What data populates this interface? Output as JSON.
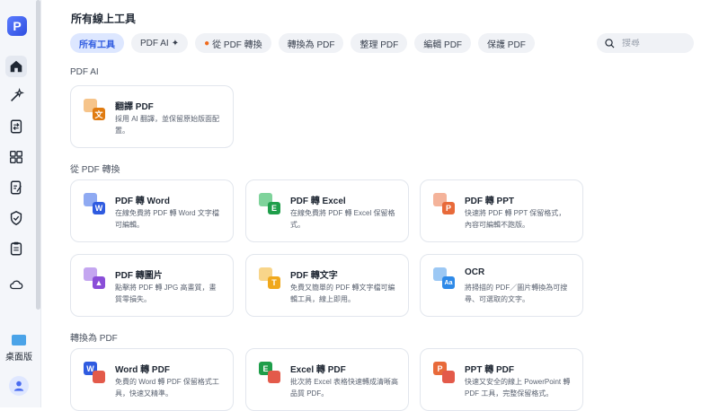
{
  "app": {
    "page_title": "所有線上工具"
  },
  "sidebar": {
    "logo_letter": "P",
    "items": [
      {
        "name": "home-icon"
      },
      {
        "name": "ai-sparkle-icon"
      },
      {
        "name": "convert-file-icon"
      },
      {
        "name": "grid-apps-icon"
      },
      {
        "name": "edit-file-icon"
      },
      {
        "name": "shield-icon"
      },
      {
        "name": "clipboard-icon"
      },
      {
        "name": "cloud-icon"
      }
    ],
    "desktop_label": "桌面版"
  },
  "tabs": [
    {
      "label": "所有工具",
      "active": true
    },
    {
      "label": "PDF AI"
    },
    {
      "label": "從 PDF 轉換"
    },
    {
      "label": "轉換為 PDF"
    },
    {
      "label": "整理 PDF"
    },
    {
      "label": "編輯 PDF"
    },
    {
      "label": "保護 PDF"
    }
  ],
  "search": {
    "placeholder": "搜尋"
  },
  "sections": [
    {
      "label": "PDF AI",
      "cards": [
        {
          "title": "翻譯 PDF",
          "desc": "採用 AI 翻譯，並保留原始版面配置。",
          "color": "#e07b10",
          "letter": "文"
        }
      ]
    },
    {
      "label": "從 PDF 轉換",
      "cards": [
        {
          "title": "PDF 轉 Word",
          "desc": "在線免費將 PDF 轉 Word 文字檔可編輯。",
          "color": "#2f5be0",
          "letter": "W"
        },
        {
          "title": "PDF 轉 Excel",
          "desc": "在線免費將 PDF 轉 Excel 保留格式。",
          "color": "#1e9e4a",
          "letter": "E"
        },
        {
          "title": "PDF 轉 PPT",
          "desc": "快速將 PDF 轉 PPT 保留格式，內容可編輯不跑版。",
          "color": "#e86a3a",
          "letter": "P"
        },
        {
          "title": "PDF 轉圖片",
          "desc": "點擊將 PDF 轉 JPG 高畫質，畫質零損失。",
          "color": "#8a4ed8",
          "letter": "▲"
        },
        {
          "title": "PDF 轉文字",
          "desc": "免費又簡單的 PDF 轉文字檔可編輯工具，線上即用。",
          "color": "#f0a81c",
          "letter": "T"
        },
        {
          "title": "OCR",
          "desc": "將掃描的 PDF／圖片轉換為可搜尋、可選取的文字。",
          "color": "#2f8ae8",
          "letter": "Aa"
        }
      ]
    },
    {
      "label": "轉換為 PDF",
      "cards": [
        {
          "title": "Word 轉 PDF",
          "desc": "免費的 Word 轉 PDF 保留格式工具，快速又精準。",
          "color": "#2f5be0",
          "letter": "W"
        },
        {
          "title": "Excel 轉 PDF",
          "desc": "批次將 Excel 表格快速轉成清晰高品質 PDF。",
          "color": "#1e9e4a",
          "letter": "E"
        },
        {
          "title": "PPT 轉 PDF",
          "desc": "快速又安全的線上 PowerPoint 轉 PDF 工具，完整保留格式。",
          "color": "#e86a3a",
          "letter": "P"
        }
      ]
    }
  ]
}
